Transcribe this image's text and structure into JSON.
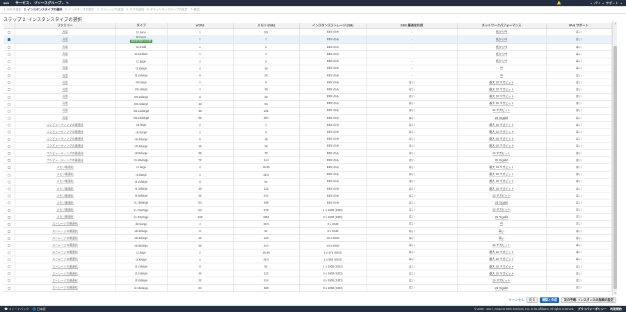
{
  "nav": {
    "logo": "aws",
    "services": "サービス",
    "resource_groups": "リソースグループ",
    "region": "パリ",
    "support": "サポート"
  },
  "wizard": {
    "steps": [
      "1. AMI の選択",
      "2. インスタンスタイプの選択",
      "3. インスタンスの設定",
      "4. ストレージの追加",
      "5. タグの追加",
      "6. セキュリティグループの設定",
      "7. 確認"
    ],
    "active_index": 1
  },
  "page_title": "ステップ 2: インスタンスタイプの選択",
  "table": {
    "headers": [
      "ファミリー",
      "タイプ",
      "vCPU",
      "メモリ (GiB)",
      "インスタンスストレージ (GB)",
      "EBS 最適化利用",
      "ネットワークパフォーマンス",
      "IPv6 サポート"
    ],
    "free_tier_label": "無料利用枠の対象",
    "selected_row": 1,
    "rows": [
      [
        "汎用",
        "t2.nano",
        "1",
        "0.5",
        "EBS のみ",
        "-",
        "低から中",
        "はい"
      ],
      [
        "汎用",
        "t2.micro",
        "1",
        "1",
        "EBS のみ",
        "-",
        "低から中",
        "はい"
      ],
      [
        "汎用",
        "t2.small",
        "1",
        "2",
        "EBS のみ",
        "-",
        "低から中",
        "はい"
      ],
      [
        "汎用",
        "t2.medium",
        "2",
        "4",
        "EBS のみ",
        "-",
        "低から中",
        "はい"
      ],
      [
        "汎用",
        "t2.large",
        "2",
        "8",
        "EBS のみ",
        "-",
        "低から中",
        "はい"
      ],
      [
        "汎用",
        "t2.xlarge",
        "4",
        "16",
        "EBS のみ",
        "-",
        "中",
        "はい"
      ],
      [
        "汎用",
        "t2.2xlarge",
        "8",
        "32",
        "EBS のみ",
        "-",
        "中",
        "はい"
      ],
      [
        "汎用",
        "m5.large",
        "2",
        "8",
        "EBS のみ",
        "はい",
        "最大 10 ギガビット",
        "はい"
      ],
      [
        "汎用",
        "m5.xlarge",
        "4",
        "16",
        "EBS のみ",
        "はい",
        "最大 10 ギガビット",
        "はい"
      ],
      [
        "汎用",
        "m5.2xlarge",
        "8",
        "32",
        "EBS のみ",
        "はい",
        "最大 10 ギガビット",
        "はい"
      ],
      [
        "汎用",
        "m5.4xlarge",
        "16",
        "64",
        "EBS のみ",
        "はい",
        "最大 10 ギガビット",
        "はい"
      ],
      [
        "汎用",
        "m5.12xlarge",
        "48",
        "192",
        "EBS のみ",
        "はい",
        "10 ギガビット",
        "はい"
      ],
      [
        "汎用",
        "m5.24xlarge",
        "96",
        "384",
        "EBS のみ",
        "はい",
        "25 Gigabit",
        "はい"
      ],
      [
        "コンピューティングの最適化",
        "c5.large",
        "2",
        "4",
        "EBS のみ",
        "はい",
        "最大 10 ギガビット",
        "はい"
      ],
      [
        "コンピューティングの最適化",
        "c5.xlarge",
        "4",
        "8",
        "EBS のみ",
        "はい",
        "最大 10 ギガビット",
        "はい"
      ],
      [
        "コンピューティングの最適化",
        "c5.2xlarge",
        "8",
        "16",
        "EBS のみ",
        "はい",
        "最大 10 ギガビット",
        "はい"
      ],
      [
        "コンピューティングの最適化",
        "c5.4xlarge",
        "16",
        "32",
        "EBS のみ",
        "はい",
        "最大 10 ギガビット",
        "はい"
      ],
      [
        "コンピューティングの最適化",
        "c5.9xlarge",
        "36",
        "72",
        "EBS のみ",
        "はい",
        "10 ギガビット",
        "はい"
      ],
      [
        "コンピューティングの最適化",
        "c5.18xlarge",
        "72",
        "144",
        "EBS のみ",
        "はい",
        "25 Gigabit",
        "はい"
      ],
      [
        "メモリ最適化",
        "r4.large",
        "2",
        "15.25",
        "EBS のみ",
        "はい",
        "最大 10 ギガビット",
        "はい"
      ],
      [
        "メモリ最適化",
        "r4.xlarge",
        "4",
        "30.5",
        "EBS のみ",
        "はい",
        "最大 10 ギガビット",
        "はい"
      ],
      [
        "メモリ最適化",
        "r4.2xlarge",
        "8",
        "61",
        "EBS のみ",
        "はい",
        "最大 10 ギガビット",
        "はい"
      ],
      [
        "メモリ最適化",
        "r4.4xlarge",
        "16",
        "122",
        "EBS のみ",
        "はい",
        "最大 10 ギガビット",
        "はい"
      ],
      [
        "メモリ最適化",
        "r4.8xlarge",
        "32",
        "244",
        "EBS のみ",
        "はい",
        "10 ギガビット",
        "はい"
      ],
      [
        "メモリ最適化",
        "r4.16xlarge",
        "64",
        "488",
        "EBS のみ",
        "はい",
        "25 Gigabit",
        "はい"
      ],
      [
        "メモリ最適化",
        "x1.16xlarge",
        "64",
        "976",
        "1 x 1920 (SSD)",
        "はい",
        "10 ギガビット",
        "はい"
      ],
      [
        "メモリ最適化",
        "x1.32xlarge",
        "128",
        "1952",
        "2 x 1920 (SSD)",
        "はい",
        "25 Gigabit",
        "はい"
      ],
      [
        "ストレージの最適化",
        "d2.xlarge",
        "4",
        "30.5",
        "3 x 2048",
        "はい",
        "中",
        "はい"
      ],
      [
        "ストレージの最適化",
        "d2.2xlarge",
        "8",
        "61",
        "6 x 2048",
        "はい",
        "高い",
        "はい"
      ],
      [
        "ストレージの最適化",
        "d2.4xlarge",
        "16",
        "122",
        "12 x 2048",
        "はい",
        "高い",
        "はい"
      ],
      [
        "ストレージの最適化",
        "d2.8xlarge",
        "36",
        "244",
        "24 x 2048",
        "はい",
        "10 ギガビット",
        "はい"
      ],
      [
        "ストレージの最適化",
        "i3.large",
        "2",
        "15.25",
        "1 x 475 (SSD)",
        "はい",
        "最大 10 ギガビット",
        "はい"
      ],
      [
        "ストレージの最適化",
        "i3.xlarge",
        "4",
        "30.5",
        "1 x 950 (SSD)",
        "はい",
        "最大 10 ギガビット",
        "はい"
      ],
      [
        "ストレージの最適化",
        "i3.2xlarge",
        "8",
        "61",
        "1 x 1900 (SSD)",
        "はい",
        "最大 10 ギガビット",
        "はい"
      ],
      [
        "ストレージの最適化",
        "i3.4xlarge",
        "16",
        "122",
        "2 x 1900 (SSD)",
        "はい",
        "最大 10 ギガビット",
        "はい"
      ],
      [
        "ストレージの最適化",
        "i3.8xlarge",
        "32",
        "244",
        "4 x 1900 (SSD)",
        "はい",
        "10 ギガビット",
        "はい"
      ],
      [
        "ストレージの最適化",
        "i3.16xlarge",
        "64",
        "488",
        "8 x 1900 (SSD)",
        "はい",
        "25 Gigabit",
        "はい"
      ]
    ]
  },
  "actions": {
    "cancel": "キャンセル",
    "previous": "戻る",
    "review": "確認と作成",
    "next": "次の手順: インスタンスの詳細の設定"
  },
  "footer": {
    "feedback": "フィードバック",
    "language": "日本語",
    "copyright": "© 2008 - 2017, Amazon Web Services, Inc. or its affiliates. All rights reserved.",
    "privacy": "プライバシーポリシー",
    "terms": "利用規約"
  }
}
